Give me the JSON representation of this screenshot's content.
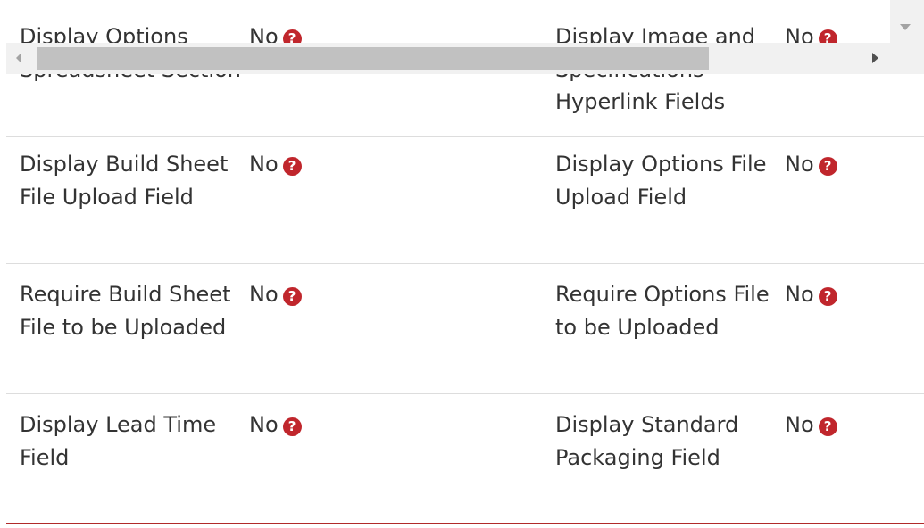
{
  "settings": {
    "rows": [
      {
        "left_label": "Display Options Spreadsheet Section",
        "left_value": "No",
        "right_label": "Display Image and Specifications Hyperlink Fields",
        "right_value": "No"
      },
      {
        "left_label": "Display Build Sheet File Upload Field",
        "left_value": "No",
        "right_label": "Display Options File Upload Field",
        "right_value": "No"
      },
      {
        "left_label": "Require Build Sheet File to be Uploaded",
        "left_value": "No",
        "right_label": "Require Options File to be Uploaded",
        "right_value": "No"
      },
      {
        "left_label": "Display Lead Time Field",
        "left_value": "No",
        "right_label": "Display Standard Packaging Field",
        "right_value": "No"
      }
    ],
    "help_icon": "question-circle-icon",
    "help_glyph": "?"
  },
  "colors": {
    "help_icon": "#c0262c",
    "divider": "#dddddd",
    "bottom_rule": "#b12a2a",
    "text": "#333333"
  }
}
